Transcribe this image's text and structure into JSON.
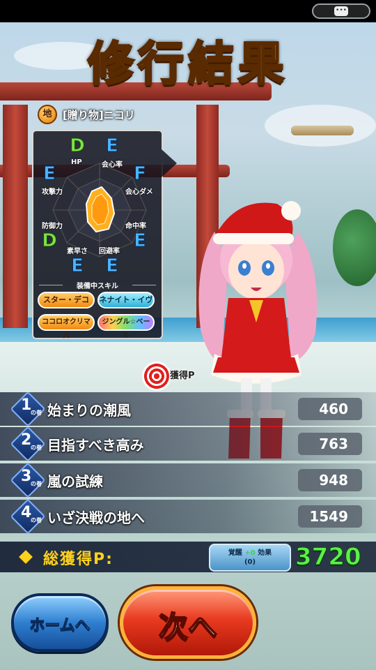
{
  "title": "修行結果",
  "status_bar": {
    "chat_icon": "chat-bubble-icon"
  },
  "character": {
    "element_badge": "地",
    "name": "[贈り物]ニコリ"
  },
  "stats": {
    "labels": {
      "hp": "HP",
      "crit_rate": "会心率",
      "crit_damage": "会心ダメ",
      "hit_rate": "命中率",
      "evasion": "回避率",
      "speed": "素早さ",
      "defense": "防御力",
      "attack": "攻撃力"
    },
    "grades": {
      "hp": "D",
      "crit_rate": "E",
      "crit_damage": "F",
      "hit_rate": "E",
      "evasion": "E",
      "speed": "E",
      "defense": "D",
      "attack": "E"
    }
  },
  "skills": {
    "title": "装備中スキル",
    "items": [
      "スター・デコ",
      "ネナイト・イヴ",
      "ココロオクリマス",
      "ジングル☆ベール"
    ]
  },
  "rewards": {
    "header": "獲得P",
    "suffix": "の巻",
    "rows": [
      {
        "num": "1",
        "name": "始まりの潮風",
        "points": "460"
      },
      {
        "num": "2",
        "name": "目指すべき高み",
        "points": "763"
      },
      {
        "num": "3",
        "name": "嵐の試練",
        "points": "948"
      },
      {
        "num": "4",
        "name": "いざ決戦の地へ",
        "points": "1549"
      }
    ],
    "total_label": "総獲得P:",
    "awakening_label": "覚醒",
    "awakening_plus": "+0",
    "awakening_suffix": "効果",
    "awakening_value": "(0)",
    "total": "3720"
  },
  "buttons": {
    "home": "ホームへ",
    "next": "次へ"
  }
}
